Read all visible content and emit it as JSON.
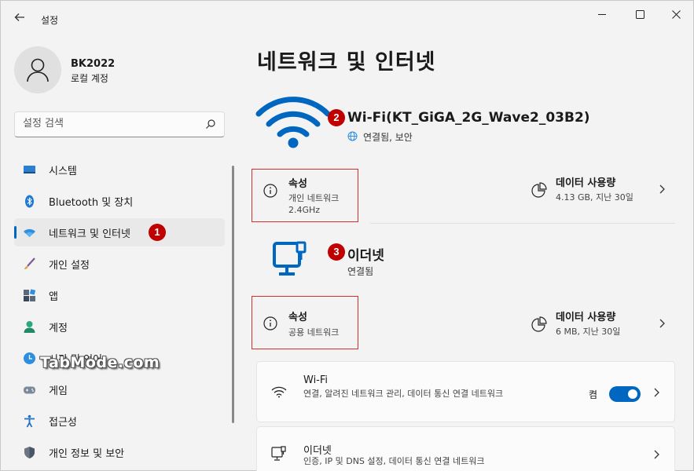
{
  "titlebar": {
    "back_icon": "arrow-left-icon",
    "title": "설정",
    "minimize": "–",
    "maximize": "☐",
    "close": "✕"
  },
  "user": {
    "name": "BK2022",
    "account": "로컬 계정"
  },
  "search": {
    "placeholder": "설정 검색"
  },
  "sidebar": {
    "items": [
      {
        "label": "시스템",
        "icon": "system-icon"
      },
      {
        "label": "Bluetooth 및 장치",
        "icon": "bluetooth-icon"
      },
      {
        "label": "네트워크 및 인터넷",
        "icon": "network-icon",
        "active": true
      },
      {
        "label": "개인 설정",
        "icon": "brush-icon"
      },
      {
        "label": "앱",
        "icon": "apps-icon"
      },
      {
        "label": "계정",
        "icon": "account-icon"
      },
      {
        "label": "시간 및 언어",
        "icon": "time-language-icon"
      },
      {
        "label": "게임",
        "icon": "gaming-icon"
      },
      {
        "label": "접근성",
        "icon": "accessibility-icon"
      },
      {
        "label": "개인 정보 및 보안",
        "icon": "shield-icon"
      }
    ]
  },
  "badges": {
    "one": "1",
    "two": "2",
    "three": "3"
  },
  "watermark": "TabMode.com",
  "main": {
    "title": "네트워크 및 인터넷",
    "wifi": {
      "name": "Wi-Fi(KT_GiGA_2G_Wave2_03B2)",
      "status": "연결됨, 보안",
      "properties": {
        "title": "속성",
        "line1": "개인 네트워크",
        "line2": "2.4GHz"
      },
      "usage": {
        "title": "데이터 사용량",
        "detail": "4.13 GB, 지난 30일"
      }
    },
    "ethernet": {
      "name": "이더넷",
      "status": "연결됨",
      "properties": {
        "title": "속성",
        "line1": "공용 네트워크"
      },
      "usage": {
        "title": "데이터 사용량",
        "detail": "6 MB, 지난 30일"
      }
    },
    "cards": [
      {
        "title": "Wi-Fi",
        "desc": "연결, 알려진 네트워크 관리, 데이터 통신 연결 네트워크",
        "toggle_label": "켬",
        "toggle_on": true
      },
      {
        "title": "이더넷",
        "desc": "인증, IP 및 DNS 설정, 데이터 통신 연결 네트워크"
      }
    ]
  },
  "colors": {
    "accent": "#0067c0",
    "badge": "#c00000",
    "highlight_border": "#d32f2f"
  }
}
